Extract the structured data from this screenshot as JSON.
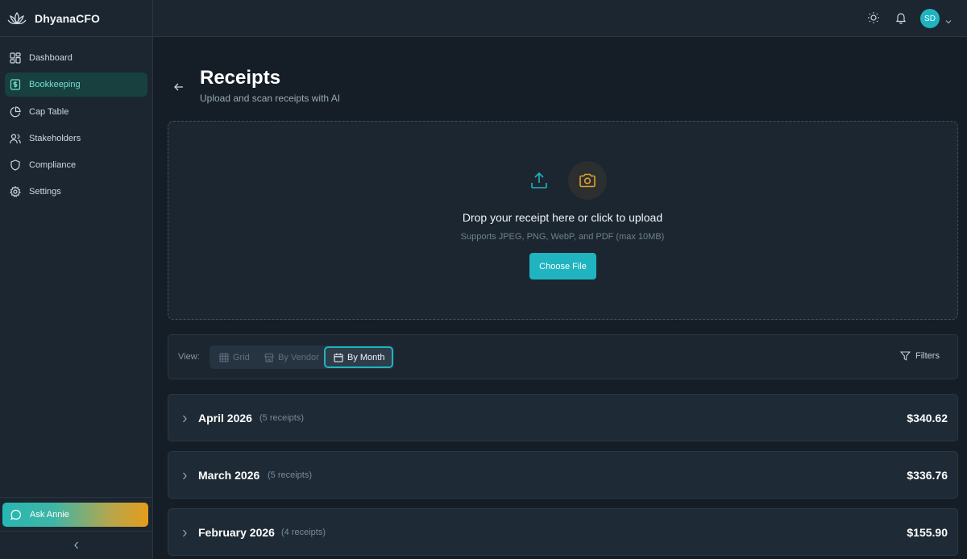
{
  "app": {
    "name": "DhyanaCFO"
  },
  "sidebar": {
    "items": [
      {
        "label": "Dashboard",
        "icon": "layout-grid-icon"
      },
      {
        "label": "Bookkeeping",
        "icon": "dollar-receipt-icon",
        "active": true
      },
      {
        "label": "Cap Table",
        "icon": "pie-chart-icon"
      },
      {
        "label": "Stakeholders",
        "icon": "users-icon"
      },
      {
        "label": "Compliance",
        "icon": "shield-icon"
      },
      {
        "label": "Settings",
        "icon": "gear-icon"
      }
    ],
    "ask_label": "Ask Annie"
  },
  "topbar": {
    "avatar_initials": "SD"
  },
  "page": {
    "title": "Receipts",
    "subtitle": "Upload and scan receipts with AI"
  },
  "upload": {
    "title": "Drop your receipt here or click to upload",
    "subtitle": "Supports JPEG, PNG, WebP, and PDF (max 10MB)",
    "button": "Choose File"
  },
  "view": {
    "label": "View:",
    "options": [
      "Grid",
      "By Vendor",
      "By Month"
    ],
    "selected": "By Month",
    "filters_label": "Filters"
  },
  "months": [
    {
      "name": "April 2026",
      "count": "(5 receipts)",
      "total": "$340.62"
    },
    {
      "name": "March 2026",
      "count": "(5 receipts)",
      "total": "$336.76"
    },
    {
      "name": "February 2026",
      "count": "(4 receipts)",
      "total": "$155.90"
    }
  ],
  "colors": {
    "accent": "#1fb4c0",
    "camera": "#e0a22b",
    "active_nav_bg": "#18403f"
  }
}
